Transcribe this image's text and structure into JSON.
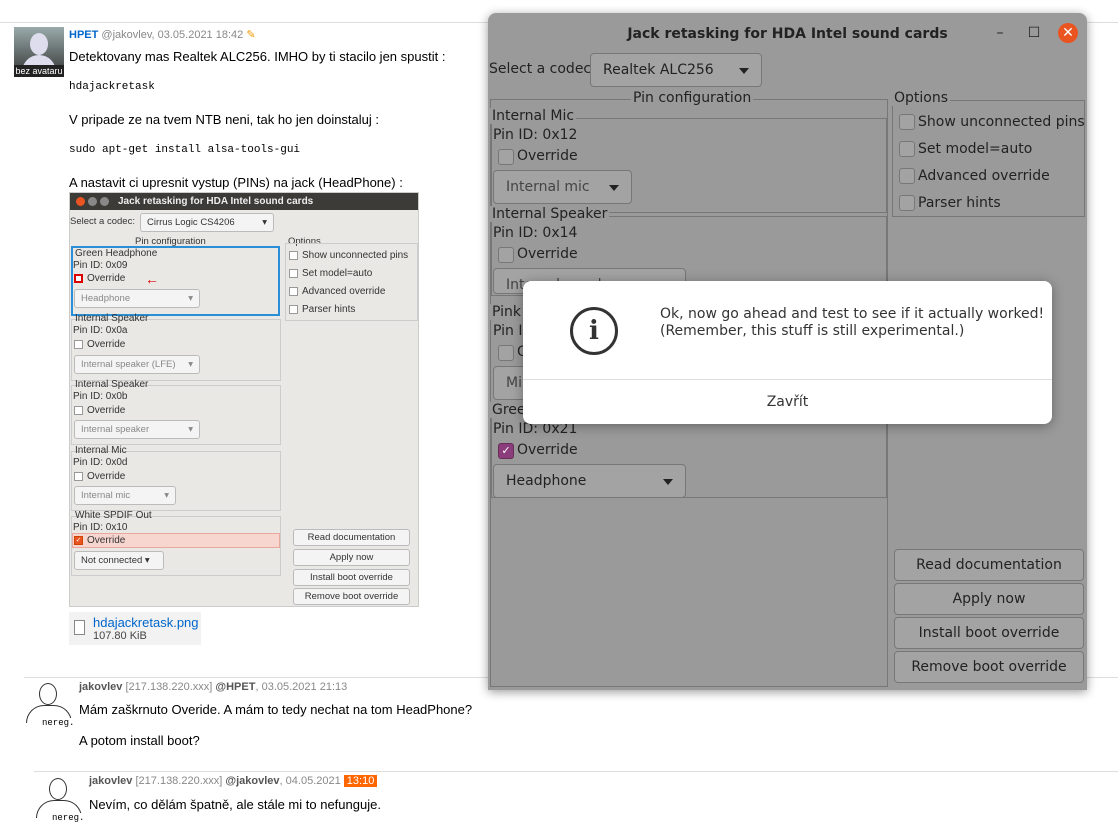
{
  "post1": {
    "avatar_caption": "bez avataru",
    "author": "HPET",
    "handle": "@jakovlev",
    "date": "03.05.2021 18:42",
    "line1": "Detektovany mas Realtek ALC256. IMHO by ti stacilo jen spustit :",
    "code1": "hdajackretask",
    "line2": "V pripade ze na tvem NTB neni, tak ho jen doinstaluj :",
    "code2": "sudo apt-get install alsa-tools-gui",
    "line3": "A nastavit ci upresnit vystup (PINs) na jack (HeadPhone) :",
    "attachment_name": "hdajackretask.png",
    "attachment_size": "107.80 KiB"
  },
  "shot": {
    "title": "Jack retasking for HDA Intel sound cards",
    "codec_label": "Select a codec:",
    "codec_value": "Cirrus Logic CS4206",
    "pin_config": "Pin configuration",
    "options": "Options",
    "opt1": "Show unconnected pins",
    "opt2": "Set model=auto",
    "opt3": "Advanced override",
    "opt4": "Parser hints",
    "g1_name": "Green Headphone",
    "g1_pin": "Pin ID: 0x09",
    "g1_override": "Override",
    "g1_combo": "Headphone",
    "g2_name": "Internal Speaker",
    "g2_pin": "Pin ID: 0x0a",
    "g2_override": "Override",
    "g2_combo": "Internal speaker (LFE)",
    "g3_name": "Internal Speaker",
    "g3_pin": "Pin ID: 0x0b",
    "g3_override": "Override",
    "g3_combo": "Internal speaker",
    "g4_name": "Internal Mic",
    "g4_pin": "Pin ID: 0x0d",
    "g4_override": "Override",
    "g4_combo": "Internal mic",
    "g5_name": "White SPDIF Out",
    "g5_pin": "Pin ID: 0x10",
    "g5_override": "Override",
    "g5_combo": "Not connected",
    "btn1": "Read documentation",
    "btn2": "Apply now",
    "btn3": "Install boot override",
    "btn4": "Remove boot override"
  },
  "reply1": {
    "avatar_caption": "nereg.",
    "author": "jakovlev",
    "ip": "[217.138.220.xxx]",
    "to": "@HPET",
    "date": "03.05.2021 21:13",
    "line1": "Mám zaškrnuto Overide. A mám to tedy nechat na tom HeadPhone?",
    "line2": "A potom install boot?"
  },
  "reply2": {
    "avatar_caption": "nereg.",
    "author": "jakovlev",
    "ip": "[217.138.220.xxx]",
    "to": "@jakovlev",
    "date": "04.05.2021",
    "time": "13:10",
    "line1": "Nevím, co dělám špatně, ale stále mi to nefunguje."
  },
  "window": {
    "title": "Jack retasking for HDA Intel sound cards",
    "minimize": "–",
    "maximize": "☐",
    "close": "✕",
    "codec_label": "Select a codec:",
    "codec_value": "Realtek ALC256",
    "pin_config": "Pin configuration",
    "options": "Options",
    "opt1": "Show unconnected pins",
    "opt2": "Set model=auto",
    "opt3": "Advanced override",
    "opt4": "Parser hints",
    "p1_name": "Internal Mic",
    "p1_pin": "Pin ID: 0x12",
    "p1_override": "Override",
    "p1_combo": "Internal mic",
    "p2_name": "Internal Speaker",
    "p2_pin": "Pin ID: 0x14",
    "p2_override": "Override",
    "p2_combo": "Internal speaker",
    "p3_name": "Pink",
    "p3_pin": "Pin I",
    "p3_override": "O",
    "p3_combo": "Mi",
    "p4_name": "Gree",
    "p4_pin": "Pin ID: 0x21",
    "p4_override": "Override",
    "p4_combo": "Headphone",
    "btn1": "Read documentation",
    "btn2": "Apply now",
    "btn3": "Install boot override",
    "btn4": "Remove boot override"
  },
  "message": {
    "icon": "i",
    "line1": "Ok, now go ahead and test to see if it actually worked!",
    "line2": "(Remember, this stuff is still experimental.)",
    "close": "Zavřít"
  }
}
